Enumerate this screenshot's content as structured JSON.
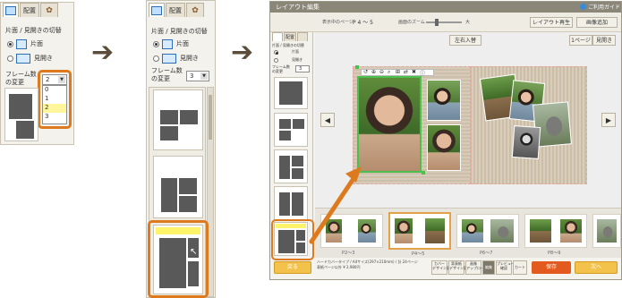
{
  "panel1": {
    "tab_labels": [
      "配置"
    ],
    "toggle_label": "片面 / 見開きの切替",
    "option_single": "片面",
    "option_spread": "見開き",
    "frame_count_label": "フレーム数\nの変更",
    "dropdown_selected": "2",
    "dropdown_options": [
      "0",
      "1",
      "2",
      "3"
    ],
    "highlighted_option": "2"
  },
  "panel2": {
    "tab_labels": [
      "配置"
    ],
    "toggle_label": "片面 / 見開きの切替",
    "option_single": "片面",
    "option_spread": "見開き",
    "frame_count_label": "フレーム数\nの変更",
    "dropdown_selected": "3"
  },
  "editor": {
    "window_title": "レイアウト編集",
    "help_link": "ご利用ガイド",
    "page_label": "表示中のページ",
    "page_value": "P 4 ～ 5",
    "zoom_label": "画面のズーム",
    "zoom_max": "大",
    "btn_top_a": "レイアウト再生",
    "btn_top_b": "画像追加",
    "tab_labels": [
      "配置"
    ],
    "toggle_label": "片面 / 見開きの切替",
    "option_single": "片面",
    "option_spread": "見開き",
    "frame_count_label": "フレーム数\nの変更",
    "dropdown_selected": "3",
    "center_btn": "左右入替",
    "view_btn": "1ページ",
    "view_btn2": "見開き",
    "nav_prev": "◀",
    "nav_next": "▶",
    "strip_labels": [
      "P2～3",
      "P4～5",
      "P6～7",
      "P8～9",
      "P10～11"
    ],
    "info_line1": "ハードカバータイプ / A4サイズ(297×210mm) / 計 24ページ",
    "info_line2": "表紙ページ以外 ¥ 2,980円",
    "footer_back": "戻る",
    "footer_mid": [
      "カバー\nデザイン変更",
      "背表紙\nデザイン変更",
      "画像\nアップロード",
      "編集",
      "プレビュー\n確認",
      "カート"
    ],
    "footer_save": "保存",
    "footer_next": "次へ"
  },
  "colors": {
    "orange": "#dd7a1e",
    "green_frame": "#4cc04c",
    "header_bar": "#8a8678",
    "page_linen": "#d4c7b3"
  }
}
